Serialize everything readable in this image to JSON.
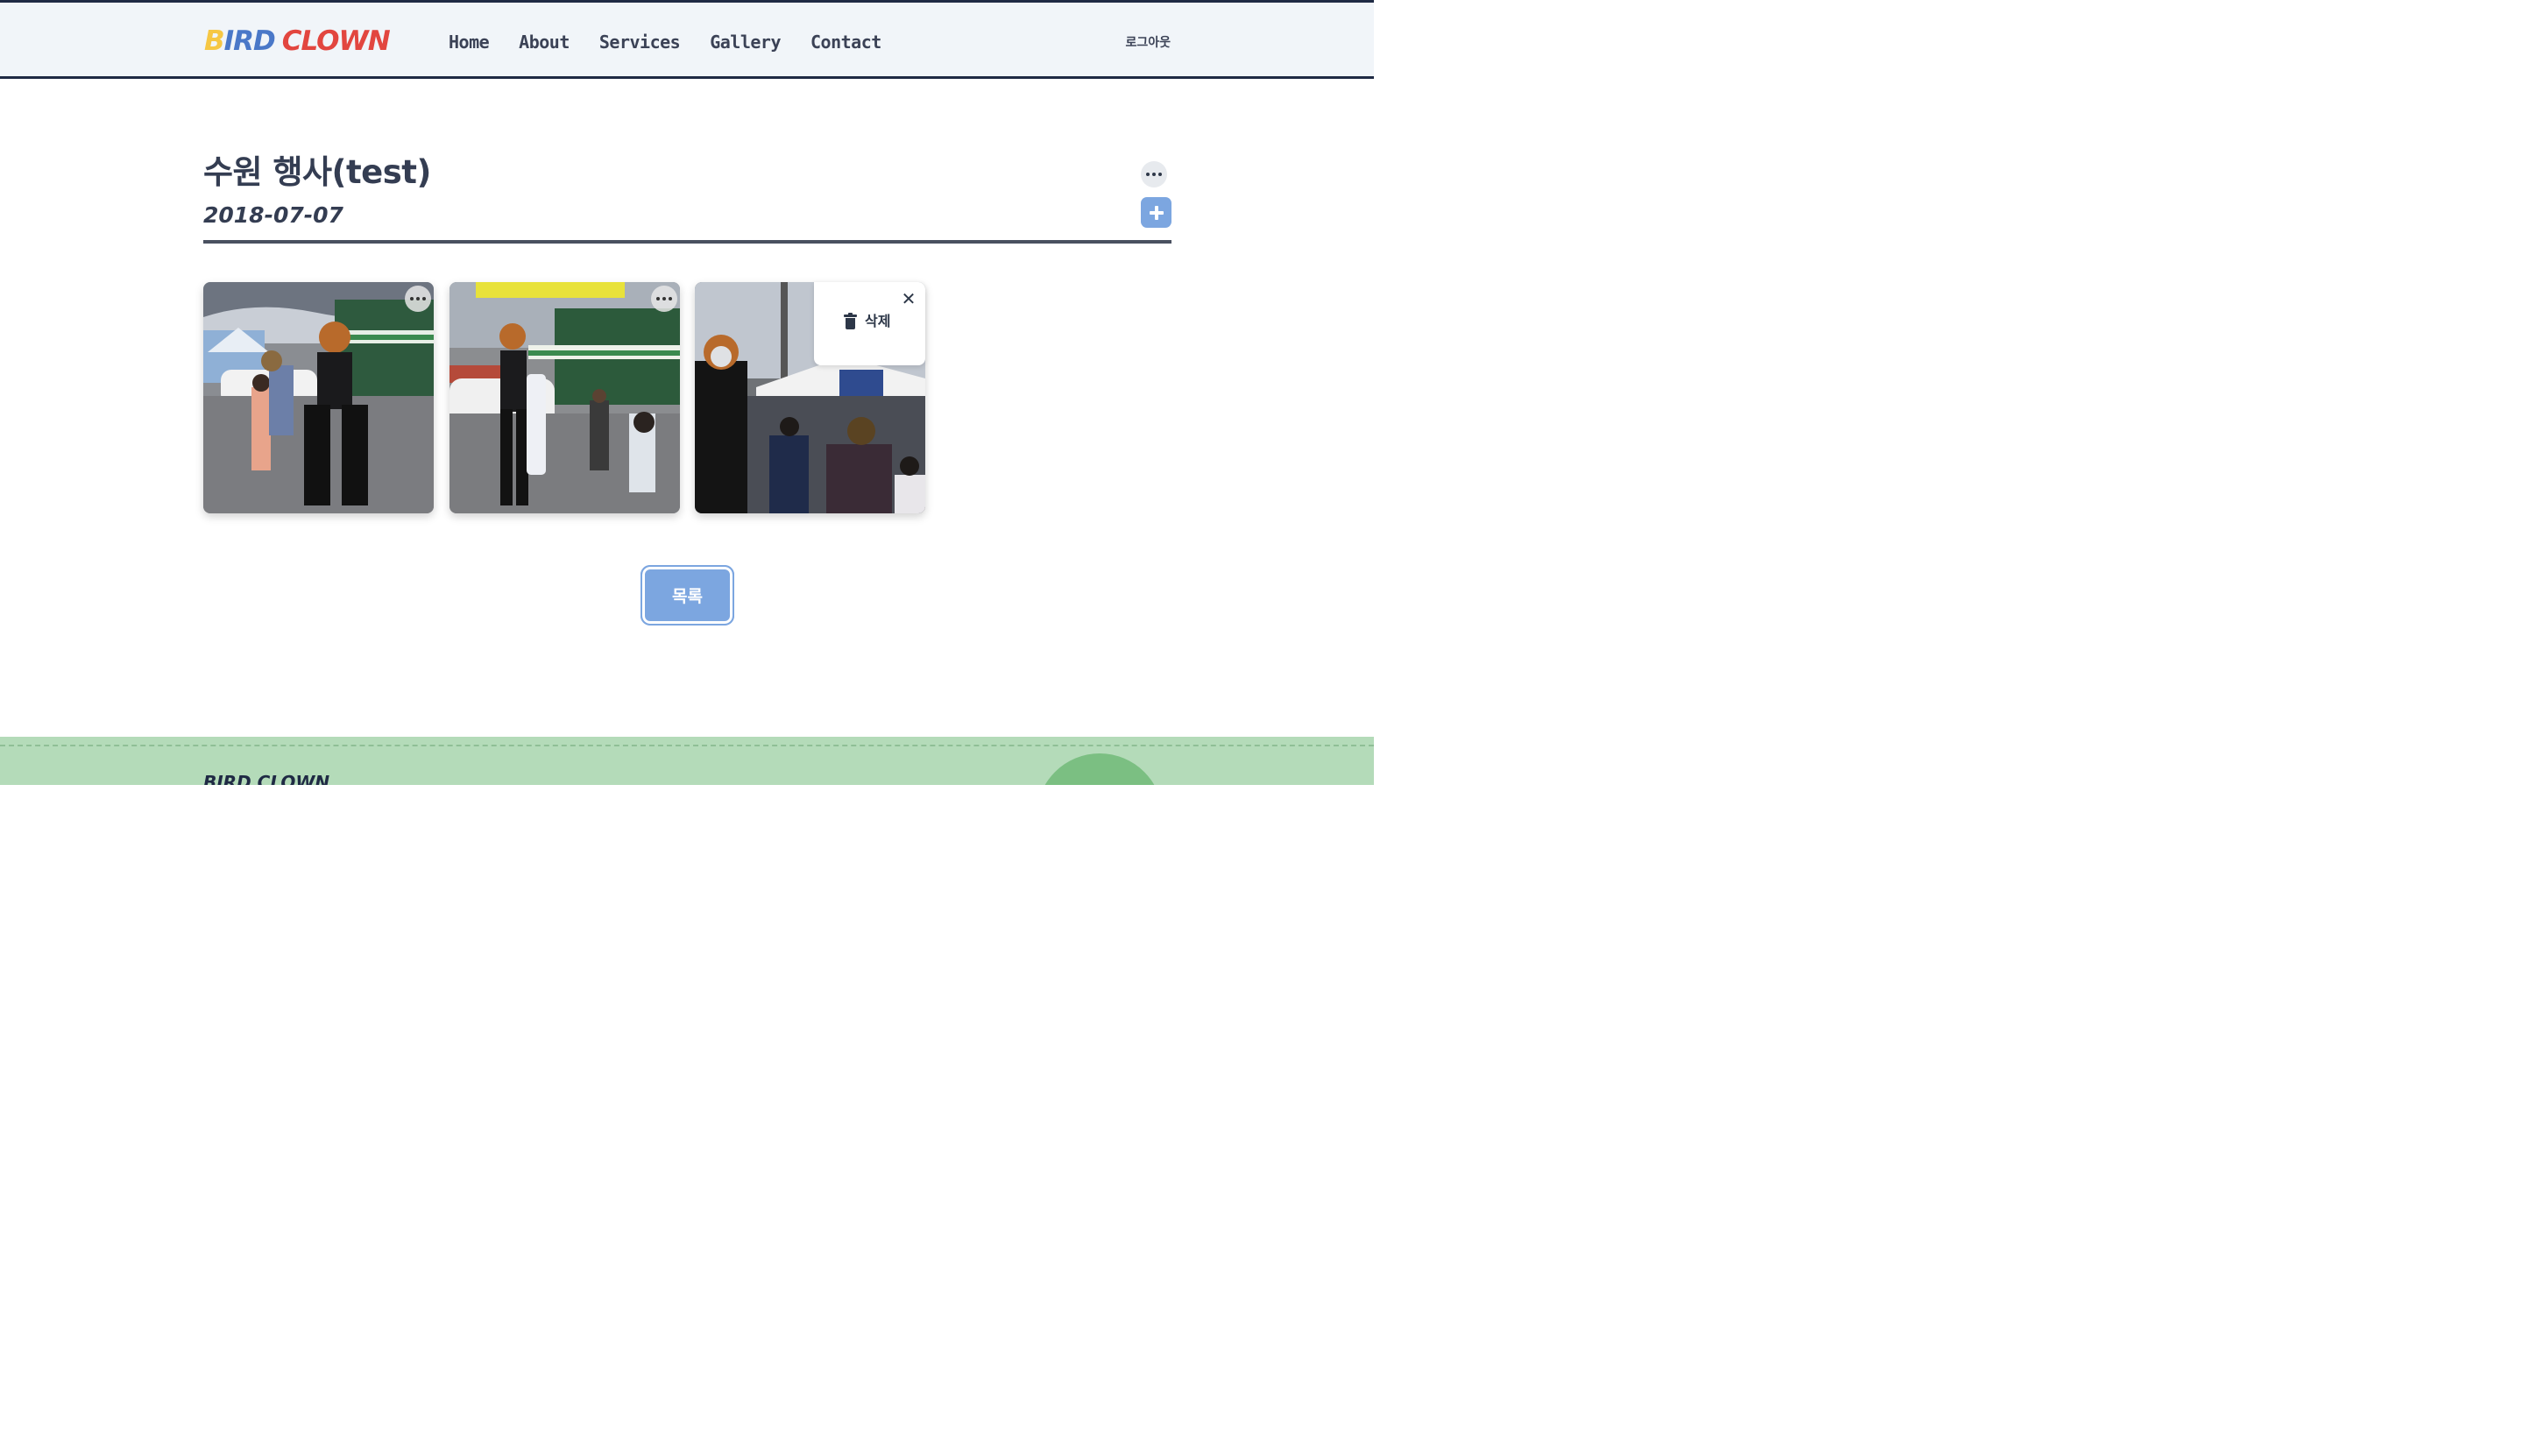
{
  "header": {
    "logo": {
      "part1": "B",
      "part2": "IRD",
      "part3": "CLOWN"
    },
    "nav": [
      "Home",
      "About",
      "Services",
      "Gallery",
      "Contact"
    ],
    "logout": "로그아웃"
  },
  "post": {
    "title": "수원 행사(test)",
    "date": "2018-07-07"
  },
  "photos": [
    {
      "alt": "street performer on stilts giving balloon to child"
    },
    {
      "alt": "stilt performer with balloon in front of market"
    },
    {
      "alt": "performer at festival tent with visitors"
    }
  ],
  "menu": {
    "delete_label": "삭제",
    "close_glyph": "✕"
  },
  "actions": {
    "list_label": "목록"
  },
  "footer": {
    "brand": "BIRD CLOWN"
  },
  "colors": {
    "accent": "#7ca6e0",
    "header_bg": "#f1f5f9",
    "footer_bg": "#b4dbb9",
    "logo_yellow": "#f6c744",
    "logo_blue": "#4a78c8",
    "logo_red": "#e2463f"
  }
}
